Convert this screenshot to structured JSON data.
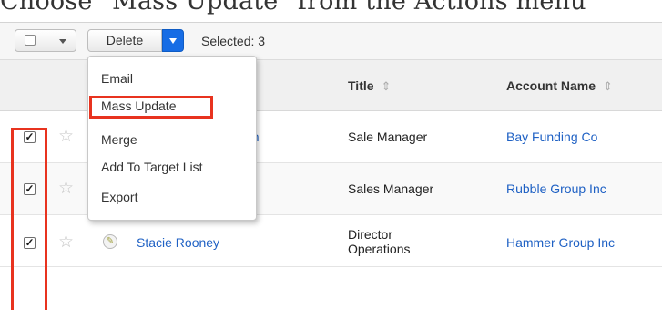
{
  "caption": "Choose \"Mass Update\" from the Actions menu",
  "toolbar": {
    "delete_label": "Delete",
    "selected_text": "Selected: 3"
  },
  "actions_menu": {
    "items": [
      "Email",
      "Mass Update",
      "Merge",
      "Add To Target List",
      "Export"
    ],
    "highlighted": "Mass Update"
  },
  "table": {
    "headers": {
      "title": "Title",
      "account_name": "Account Name"
    },
    "rows": [
      {
        "checked": true,
        "name_fragment": "son",
        "title": "Sale Manager",
        "account": "Bay Funding Co"
      },
      {
        "checked": true,
        "name_fragment": "",
        "title": "Sales Manager",
        "account": "Rubble Group Inc"
      },
      {
        "checked": true,
        "name": "Stacie Rooney",
        "title_line1": "Director",
        "title_line2": "Operations",
        "account": "Hammer Group Inc"
      }
    ]
  },
  "icons": {
    "check": "checkbox-checked-icon",
    "star": "favorite-star-icon",
    "edit": "edit-pencil-icon",
    "caret": "chevron-down-icon",
    "sort": "sort-icon"
  },
  "colors": {
    "accent_blue": "#176de5",
    "link_blue": "#1f61c4",
    "highlight_red": "#e8331f"
  }
}
